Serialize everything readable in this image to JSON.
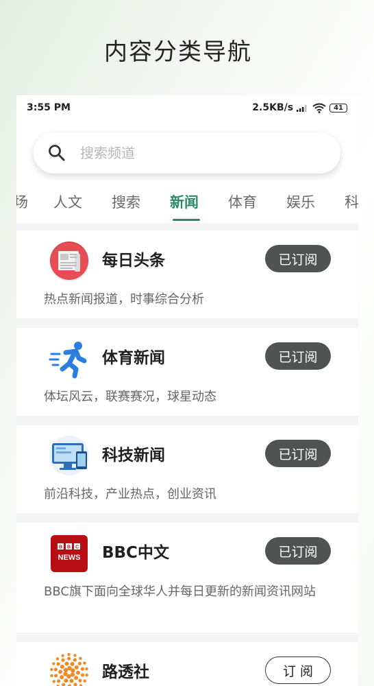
{
  "promo": {
    "title": "内容分类导航"
  },
  "status": {
    "time": "3:55 PM",
    "speed": "2.5KB/s",
    "battery": "41"
  },
  "search": {
    "placeholder": "搜索频道"
  },
  "tabs": [
    "场",
    "人文",
    "搜索",
    "新闻",
    "体育",
    "娱乐",
    "科"
  ],
  "active_tab": "新闻",
  "channels": [
    {
      "title": "每日头条",
      "desc": "热点新闻报道，时事综合分析",
      "button": "已订阅",
      "subscribed": true,
      "icon": "newspaper-icon"
    },
    {
      "title": "体育新闻",
      "desc": "体坛风云，联赛赛况，球星动态",
      "button": "已订阅",
      "subscribed": true,
      "icon": "runner-icon"
    },
    {
      "title": "科技新闻",
      "desc": "前沿科技，产业热点，创业资讯",
      "button": "已订阅",
      "subscribed": true,
      "icon": "devices-icon"
    },
    {
      "title": "BBC中文",
      "desc": "BBC旗下面向全球华人并每日更新的新闻资讯网站",
      "button": "已订阅",
      "subscribed": true,
      "icon": "bbc-news-logo",
      "logo_text": [
        "BBC",
        "NEWS"
      ]
    },
    {
      "title": "路透社",
      "desc": "",
      "button": "订 阅",
      "subscribed": false,
      "icon": "reuters-logo"
    }
  ],
  "colors": {
    "accent": "#2a8c66",
    "subscribed_bg": "#4f5351",
    "card_bg": "#ffffff",
    "list_bg": "#f5f5f7"
  }
}
